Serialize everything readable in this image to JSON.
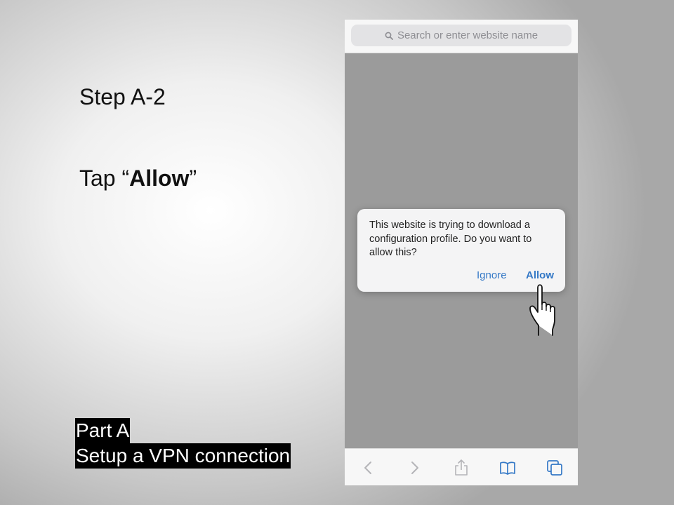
{
  "slide": {
    "step_title": "Step A-2",
    "instruction_prefix": "Tap “",
    "instruction_bold": "Allow",
    "instruction_suffix": "”",
    "part_label": "Part A",
    "part_subtitle": "Setup a VPN connection"
  },
  "browser": {
    "search_placeholder": "Search or enter website name",
    "toolbar": [
      "back-icon",
      "forward-icon",
      "share-icon",
      "bookmarks-icon",
      "tabs-icon"
    ]
  },
  "dialog": {
    "message": "This website is trying to download a configuration profile. Do you want to allow this?",
    "ignore_label": "Ignore",
    "allow_label": "Allow"
  },
  "colors": {
    "accent": "#3478c6",
    "part_bg": "#000000"
  }
}
